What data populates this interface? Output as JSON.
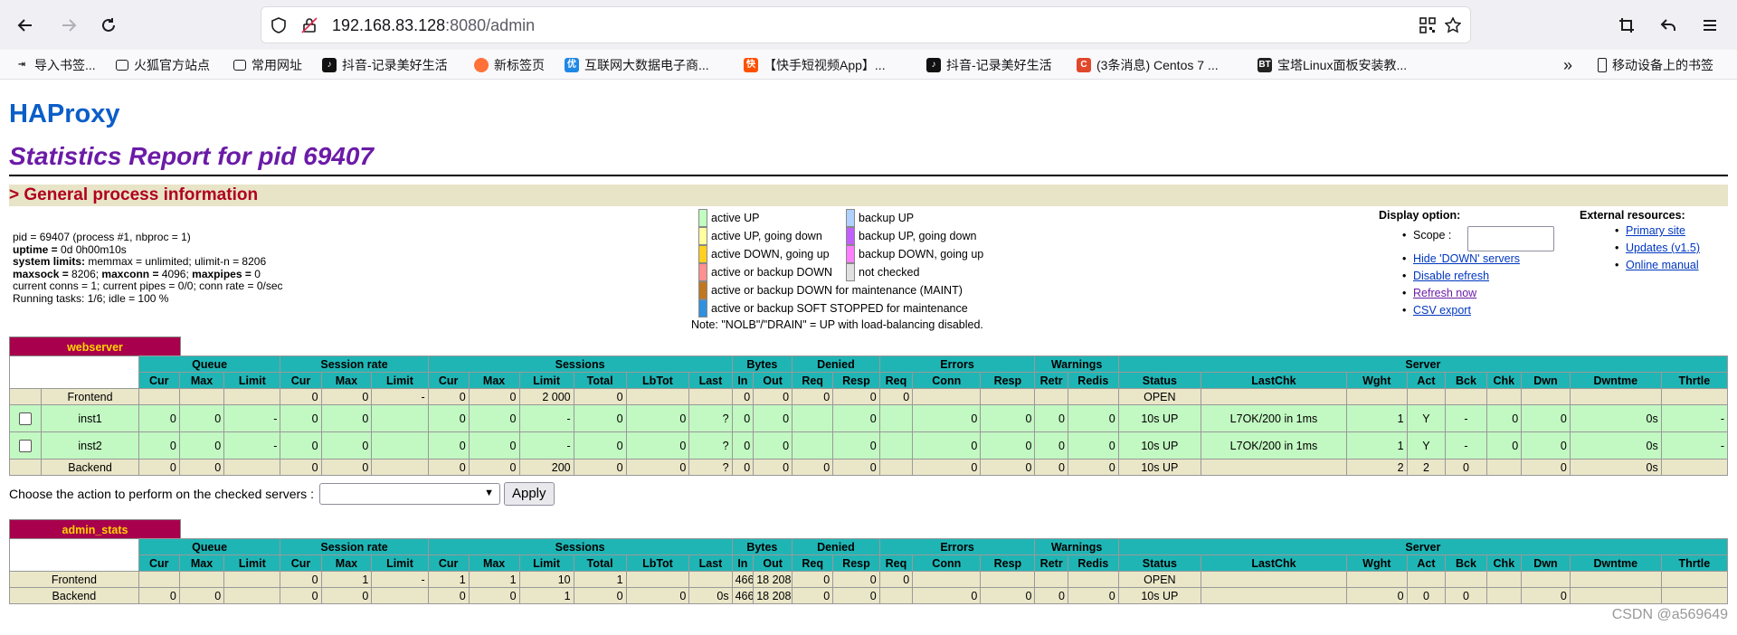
{
  "browser": {
    "url_host": "192.168.83.128",
    "url_rest": ":8080/admin",
    "bookmarks": [
      "导入书签...",
      "火狐官方站点",
      "常用网址",
      "抖音-记录美好生活",
      "新标签页",
      "互联网大数据电子商...",
      "【快手短视频App】...",
      "抖音-记录美好生活",
      "(3条消息) Centos 7 ...",
      "宝塔Linux面板安装教...",
      "移动设备上的书签"
    ]
  },
  "page": {
    "brand": "HAProxy",
    "title": "Statistics Report for pid 69407",
    "section": "> General process information",
    "info": [
      [
        [
          "pid = ",
          "n"
        ],
        [
          "69407 (process #1, nbproc = 1)",
          "n"
        ]
      ],
      [
        [
          "uptime = ",
          "b"
        ],
        [
          "0d 0h00m10s",
          "n"
        ]
      ],
      [
        [
          "system limits: ",
          "b"
        ],
        [
          "memmax = unlimited; ulimit-n = 8206",
          "n"
        ]
      ],
      [
        [
          "maxsock = ",
          "b"
        ],
        [
          "8206; ",
          "n"
        ],
        [
          "maxconn = ",
          "b"
        ],
        [
          "4096; ",
          "n"
        ],
        [
          "maxpipes = ",
          "b"
        ],
        [
          "0",
          "n"
        ]
      ],
      [
        [
          "current conns = 1; current pipes = 0/0; conn rate = 0/sec",
          "n"
        ]
      ],
      [
        [
          "Running tasks: 1/6; idle = 100 %",
          "n"
        ]
      ]
    ],
    "legend_left": [
      {
        "label": "active UP",
        "color": "#c0ffc0"
      },
      {
        "label": "active UP, going down",
        "color": "#ffffa0"
      },
      {
        "label": "active DOWN, going up",
        "color": "#ffd020"
      },
      {
        "label": "active or backup DOWN",
        "color": "#ff9090"
      },
      {
        "label": "active or backup DOWN for maintenance (MAINT)",
        "color": "#c07820"
      },
      {
        "label": "active or backup SOFT STOPPED for maintenance",
        "color": "#3090e0"
      }
    ],
    "legend_right": [
      {
        "label": "backup UP",
        "color": "#b0d0ff"
      },
      {
        "label": "backup UP, going down",
        "color": "#c060ff"
      },
      {
        "label": "backup DOWN, going up",
        "color": "#ff80ff"
      },
      {
        "label": "not checked",
        "color": "#e0e0e0"
      }
    ],
    "legend_note": "Note: \"NOLB\"/\"DRAIN\" = UP with load-balancing disabled.",
    "display_option": {
      "title": "Display option:",
      "scope_label": "Scope :",
      "links": [
        "Hide 'DOWN' servers",
        "Disable refresh",
        "Refresh now",
        "CSV export"
      ]
    },
    "external": {
      "title": "External resources:",
      "links": [
        "Primary site",
        "Updates (v1.5)",
        "Online manual"
      ]
    },
    "action_label": "Choose the action to perform on the checked servers :",
    "apply_label": "Apply",
    "watermark": "CSDN @a569649"
  },
  "groups": [
    "Queue",
    "Session rate",
    "Sessions",
    "Bytes",
    "Denied",
    "Errors",
    "Warnings",
    "Server"
  ],
  "cols": [
    "Cur",
    "Max",
    "Limit",
    "Cur",
    "Max",
    "Limit",
    "Cur",
    "Max",
    "Limit",
    "Total",
    "LbTot",
    "Last",
    "In",
    "Out",
    "Req",
    "Resp",
    "Req",
    "Conn",
    "Resp",
    "Retr",
    "Redis",
    "Status",
    "LastChk",
    "Wght",
    "Act",
    "Bck",
    "Chk",
    "Dwn",
    "Dwntme",
    "Thrtle"
  ],
  "proxies": [
    {
      "name": "webserver",
      "rows": [
        {
          "kind": "fe",
          "cells": [
            "Frontend",
            "",
            "",
            "",
            "0",
            "0",
            "-",
            "0",
            "0",
            "2 000",
            "0",
            "",
            "",
            "0",
            "0",
            "0",
            "0",
            "0",
            "",
            "",
            "",
            "",
            "OPEN",
            "",
            "",
            "",
            "",
            "",
            "",
            "",
            ""
          ]
        },
        {
          "kind": "sv",
          "cells": [
            "inst1",
            "0",
            "0",
            "-",
            "0",
            "0",
            "",
            "0",
            "0",
            "-",
            "0",
            "0",
            "?",
            "0",
            "0",
            "",
            "0",
            "",
            "0",
            "0",
            "0",
            "0",
            "10s UP",
            "L7OK/200 in 1ms",
            "1",
            "Y",
            "-",
            "0",
            "0",
            "0s",
            "-"
          ]
        },
        {
          "kind": "sv",
          "cells": [
            "inst2",
            "0",
            "0",
            "-",
            "0",
            "0",
            "",
            "0",
            "0",
            "-",
            "0",
            "0",
            "?",
            "0",
            "0",
            "",
            "0",
            "",
            "0",
            "0",
            "0",
            "0",
            "10s UP",
            "L7OK/200 in 1ms",
            "1",
            "Y",
            "-",
            "0",
            "0",
            "0s",
            "-"
          ]
        },
        {
          "kind": "be",
          "cells": [
            "Backend",
            "0",
            "0",
            "",
            "0",
            "0",
            "",
            "0",
            "0",
            "200",
            "0",
            "0",
            "?",
            "0",
            "0",
            "0",
            "0",
            "",
            "0",
            "0",
            "0",
            "0",
            "10s UP",
            "",
            "2",
            "2",
            "0",
            "",
            "0",
            "0s",
            ""
          ]
        }
      ]
    },
    {
      "name": "admin_stats",
      "rows": [
        {
          "kind": "fe",
          "cells": [
            "Frontend",
            "",
            "",
            "",
            "0",
            "1",
            "-",
            "1",
            "1",
            "10",
            "1",
            "",
            "",
            "466",
            "18 208",
            "0",
            "0",
            "0",
            "",
            "",
            "",
            "",
            "OPEN",
            "",
            "",
            "",
            "",
            "",
            "",
            "",
            ""
          ]
        },
        {
          "kind": "be",
          "cells": [
            "Backend",
            "0",
            "0",
            "",
            "0",
            "0",
            "",
            "0",
            "0",
            "1",
            "0",
            "0",
            "0s",
            "466",
            "18 208",
            "0",
            "0",
            "",
            "0",
            "0",
            "0",
            "0",
            "10s UP",
            "",
            "0",
            "0",
            "0",
            "",
            "0",
            "",
            ""
          ]
        }
      ]
    }
  ]
}
